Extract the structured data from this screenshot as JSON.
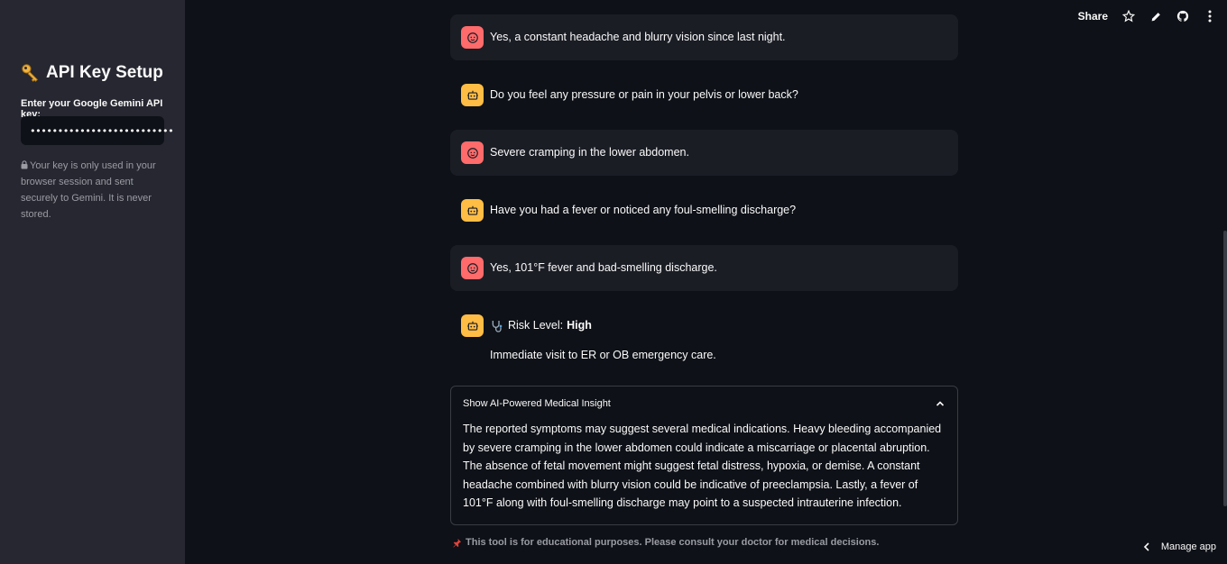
{
  "sidebar": {
    "title": "API Key Setup",
    "input_label": "Enter your Google Gemini API key:",
    "input_value": "••••••••••••••••••••••••••",
    "note": "Your key is only used in your browser session and sent securely to Gemini. It is never stored."
  },
  "header": {
    "share_label": "Share",
    "icons": [
      "star-icon",
      "pencil-icon",
      "github-icon",
      "more-vertical-icon"
    ]
  },
  "chat": {
    "messages": [
      {
        "role": "user",
        "text": "Yes, a constant headache and blurry vision since last night."
      },
      {
        "role": "assistant",
        "text": "Do you feel any pressure or pain in your pelvis or lower back?"
      },
      {
        "role": "user",
        "text": "Severe cramping in the lower abdomen."
      },
      {
        "role": "assistant",
        "text": "Have you had a fever or noticed any foul-smelling discharge?"
      },
      {
        "role": "user",
        "text": "Yes, 101°F fever and bad-smelling discharge."
      }
    ],
    "risk": {
      "label": "Risk Level:",
      "value": "High",
      "action": "Immediate visit to ER or OB emergency care."
    }
  },
  "expander": {
    "label": "Show AI-Powered Medical Insight",
    "body": "The reported symptoms may suggest several medical indications. Heavy bleeding accompanied by severe cramping in the lower abdomen could indicate a miscarriage or placental abruption. The absence of fetal movement might suggest fetal distress, hypoxia, or demise. A constant headache combined with blurry vision could be indicative of preeclampsia. Lastly, a fever of 101°F along with foul-smelling discharge may point to a suspected intrauterine infection."
  },
  "footer": {
    "text": "This tool is for educational purposes. Please consult your doctor for medical decisions."
  },
  "manage_app": "Manage app",
  "colors": {
    "background": "#0e1117",
    "sidebar": "#262730",
    "user_avatar": "#ff6b6b",
    "assistant_avatar": "#ffbd45",
    "user_bubble": "#1b1d25"
  }
}
